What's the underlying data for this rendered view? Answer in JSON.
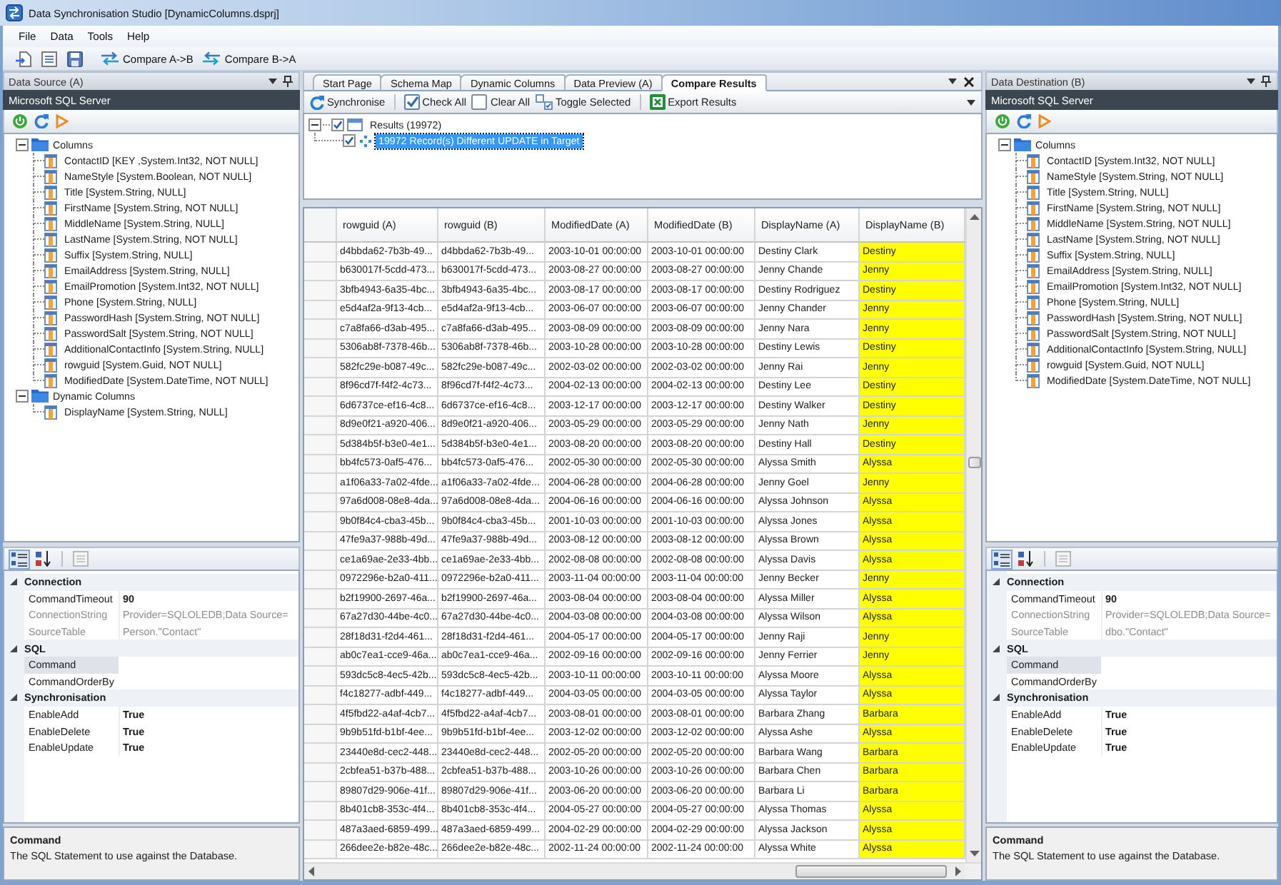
{
  "window": {
    "title": "Data Synchronisation Studio [DynamicColumns.dsprj]"
  },
  "menu": [
    {
      "label": "File"
    },
    {
      "label": "Data"
    },
    {
      "label": "Tools"
    },
    {
      "label": "Help"
    }
  ],
  "toolbar": [
    {
      "label": "Compare A->B"
    },
    {
      "label": "Compare B->A"
    }
  ],
  "source": {
    "title": "Data Source (A)",
    "provider": "Microsoft SQL Server",
    "tree": [
      {
        "label": "Columns",
        "expanded": true,
        "children": [
          {
            "label": "ContactID [KEY ,System.Int32, NOT NULL]"
          },
          {
            "label": "NameStyle [System.Boolean, NOT NULL]"
          },
          {
            "label": "Title [System.String, NULL]"
          },
          {
            "label": "FirstName [System.String, NOT NULL]"
          },
          {
            "label": "MiddleName [System.String, NULL]"
          },
          {
            "label": "LastName [System.String, NOT NULL]"
          },
          {
            "label": "Suffix [System.String, NULL]"
          },
          {
            "label": "EmailAddress [System.String, NULL]"
          },
          {
            "label": "EmailPromotion [System.Int32, NOT NULL]"
          },
          {
            "label": "Phone [System.String, NULL]"
          },
          {
            "label": "PasswordHash [System.String, NOT NULL]"
          },
          {
            "label": "PasswordSalt [System.String, NOT NULL]"
          },
          {
            "label": "AdditionalContactInfo [System.String, NULL]"
          },
          {
            "label": "rowguid [System.Guid, NOT NULL]"
          },
          {
            "label": "ModifiedDate [System.DateTime, NOT NULL]"
          }
        ]
      },
      {
        "label": "Dynamic Columns",
        "expanded": true,
        "children": [
          {
            "label": "DisplayName [System.String, NULL]"
          }
        ]
      }
    ],
    "property_views": [
      {
        "kind": "categorized",
        "selected": true,
        "disabled": false
      },
      {
        "kind": "alphabetical",
        "selected": false,
        "disabled": false
      },
      {
        "kind": "pages",
        "selected": false,
        "disabled": true
      }
    ],
    "properties": [
      {
        "category": "Connection",
        "expanded": true,
        "items": [
          {
            "name": "CommandTimeout",
            "value": "90",
            "modified": true,
            "readonly": false,
            "selected": false
          },
          {
            "name": "ConnectionString",
            "value": "Provider=SQLOLEDB;Data Source=",
            "modified": false,
            "readonly": true,
            "selected": false
          },
          {
            "name": "SourceTable",
            "value": "Person.\"Contact\"",
            "modified": false,
            "readonly": true,
            "selected": false
          }
        ]
      },
      {
        "category": "SQL",
        "expanded": true,
        "items": [
          {
            "name": "Command",
            "readonly": false,
            "selected": true
          },
          {
            "name": "CommandOrderBy",
            "readonly": false,
            "selected": false
          }
        ]
      },
      {
        "category": "Synchronisation",
        "expanded": true,
        "items": [
          {
            "name": "EnableAdd",
            "value": "True",
            "modified": true,
            "readonly": false,
            "selected": false
          },
          {
            "name": "EnableDelete",
            "value": "True",
            "modified": true,
            "readonly": false,
            "selected": false
          },
          {
            "name": "EnableUpdate",
            "value": "True",
            "modified": true,
            "readonly": false,
            "selected": false
          }
        ]
      }
    ],
    "description": {
      "title": "Command",
      "text": "The SQL Statement to use against the Database."
    }
  },
  "results": {
    "tabs": [
      {
        "label": "Start Page",
        "selected": false
      },
      {
        "label": "Schema Map",
        "selected": false
      },
      {
        "label": "Dynamic Columns",
        "selected": false
      },
      {
        "label": "Data Preview (A)",
        "selected": false
      },
      {
        "label": "Compare Results",
        "selected": true
      }
    ],
    "toolbar": [
      {
        "kind": "sync",
        "label": "Synchronise"
      },
      {
        "kind": "separator"
      },
      {
        "kind": "check",
        "label": "Check All"
      },
      {
        "kind": "clear",
        "label": "Clear All"
      },
      {
        "kind": "toggle",
        "label": "Toggle Selected"
      },
      {
        "kind": "separator"
      },
      {
        "kind": "export",
        "label": "Export Results"
      }
    ],
    "tree": [
      {
        "label": "Results (19972)",
        "checked": true,
        "expanded": true,
        "selected": false,
        "children": [
          {
            "label": "19972 Record(s) Different UPDATE in Target",
            "checked": true,
            "selected": true
          }
        ]
      }
    ],
    "grid": {
      "columns": [
        {
          "label": "rowguid (A)",
          "highlighted": false
        },
        {
          "label": "rowguid (B)",
          "highlighted": false
        },
        {
          "label": "ModifiedDate (A)",
          "highlighted": false
        },
        {
          "label": "ModifiedDate (B)",
          "highlighted": false
        },
        {
          "label": "DisplayName (A)",
          "highlighted": false
        },
        {
          "label": "DisplayName (B)",
          "highlighted": true
        }
      ],
      "rows": [
        [
          "d4bbda62-7b3b-49...",
          "d4bbda62-7b3b-49...",
          "2003-10-01 00:00:00",
          "2003-10-01 00:00:00",
          "Destiny Clark",
          "Destiny"
        ],
        [
          "b630017f-5cdd-473...",
          "b630017f-5cdd-473...",
          "2003-08-27 00:00:00",
          "2003-08-27 00:00:00",
          "Jenny Chande",
          "Jenny"
        ],
        [
          "3bfb4943-6a35-4bc...",
          "3bfb4943-6a35-4bc...",
          "2003-08-17 00:00:00",
          "2003-08-17 00:00:00",
          "Destiny Rodriguez",
          "Destiny"
        ],
        [
          "e5d4af2a-9f13-4cb...",
          "e5d4af2a-9f13-4cb...",
          "2003-06-07 00:00:00",
          "2003-06-07 00:00:00",
          "Jenny Chander",
          "Jenny"
        ],
        [
          "c7a8fa66-d3ab-495...",
          "c7a8fa66-d3ab-495...",
          "2003-08-09 00:00:00",
          "2003-08-09 00:00:00",
          "Jenny Nara",
          "Jenny"
        ],
        [
          "5306ab8f-7378-46b...",
          "5306ab8f-7378-46b...",
          "2003-10-28 00:00:00",
          "2003-10-28 00:00:00",
          "Destiny Lewis",
          "Destiny"
        ],
        [
          "582fc29e-b087-49c...",
          "582fc29e-b087-49c...",
          "2002-03-02 00:00:00",
          "2002-03-02 00:00:00",
          "Jenny Rai",
          "Jenny"
        ],
        [
          "8f96cd7f-f4f2-4c73...",
          "8f96cd7f-f4f2-4c73...",
          "2004-02-13 00:00:00",
          "2004-02-13 00:00:00",
          "Destiny Lee",
          "Destiny"
        ],
        [
          "6d6737ce-ef16-4c8...",
          "6d6737ce-ef16-4c8...",
          "2003-12-17 00:00:00",
          "2003-12-17 00:00:00",
          "Destiny Walker",
          "Destiny"
        ],
        [
          "8d9e0f21-a920-406...",
          "8d9e0f21-a920-406...",
          "2003-05-29 00:00:00",
          "2003-05-29 00:00:00",
          "Jenny Nath",
          "Jenny"
        ],
        [
          "5d384b5f-b3e0-4e1...",
          "5d384b5f-b3e0-4e1...",
          "2003-08-20 00:00:00",
          "2003-08-20 00:00:00",
          "Destiny Hall",
          "Destiny"
        ],
        [
          "bb4fc573-0af5-476...",
          "bb4fc573-0af5-476...",
          "2002-05-30 00:00:00",
          "2002-05-30 00:00:00",
          "Alyssa Smith",
          "Alyssa"
        ],
        [
          "a1f06a33-7a02-4fde...",
          "a1f06a33-7a02-4fde...",
          "2004-06-28 00:00:00",
          "2004-06-28 00:00:00",
          "Jenny Goel",
          "Jenny"
        ],
        [
          "97a6d008-08e8-4da...",
          "97a6d008-08e8-4da...",
          "2004-06-16 00:00:00",
          "2004-06-16 00:00:00",
          "Alyssa Johnson",
          "Alyssa"
        ],
        [
          "9b0f84c4-cba3-45b...",
          "9b0f84c4-cba3-45b...",
          "2001-10-03 00:00:00",
          "2001-10-03 00:00:00",
          "Alyssa Jones",
          "Alyssa"
        ],
        [
          "47fe9a37-988b-49d...",
          "47fe9a37-988b-49d...",
          "2003-08-12 00:00:00",
          "2003-08-12 00:00:00",
          "Alyssa Brown",
          "Alyssa"
        ],
        [
          "ce1a69ae-2e33-4bb...",
          "ce1a69ae-2e33-4bb...",
          "2002-08-08 00:00:00",
          "2002-08-08 00:00:00",
          "Alyssa Davis",
          "Alyssa"
        ],
        [
          "0972296e-b2a0-411...",
          "0972296e-b2a0-411...",
          "2003-11-04 00:00:00",
          "2003-11-04 00:00:00",
          "Jenny Becker",
          "Jenny"
        ],
        [
          "b2f19900-2697-46a...",
          "b2f19900-2697-46a...",
          "2003-08-04 00:00:00",
          "2003-08-04 00:00:00",
          "Alyssa Miller",
          "Alyssa"
        ],
        [
          "67a27d30-44be-4c0...",
          "67a27d30-44be-4c0...",
          "2004-03-08 00:00:00",
          "2004-03-08 00:00:00",
          "Alyssa Wilson",
          "Alyssa"
        ],
        [
          "28f18d31-f2d4-461...",
          "28f18d31-f2d4-461...",
          "2004-05-17 00:00:00",
          "2004-05-17 00:00:00",
          "Jenny Raji",
          "Jenny"
        ],
        [
          "ab0c7ea1-cce9-46a...",
          "ab0c7ea1-cce9-46a...",
          "2002-09-16 00:00:00",
          "2002-09-16 00:00:00",
          "Jenny Ferrier",
          "Jenny"
        ],
        [
          "593dc5c8-4ec5-42b...",
          "593dc5c8-4ec5-42b...",
          "2003-10-11 00:00:00",
          "2003-10-11 00:00:00",
          "Alyssa Moore",
          "Alyssa"
        ],
        [
          "f4c18277-adbf-449...",
          "f4c18277-adbf-449...",
          "2004-03-05 00:00:00",
          "2004-03-05 00:00:00",
          "Alyssa Taylor",
          "Alyssa"
        ],
        [
          "4f5fbd22-a4af-4cb7...",
          "4f5fbd22-a4af-4cb7...",
          "2003-08-01 00:00:00",
          "2003-08-01 00:00:00",
          "Barbara Zhang",
          "Barbara"
        ],
        [
          "9b9b51fd-b1bf-4ee...",
          "9b9b51fd-b1bf-4ee...",
          "2003-12-02 00:00:00",
          "2003-12-02 00:00:00",
          "Alyssa Ashe",
          "Alyssa"
        ],
        [
          "23440e8d-cec2-448...",
          "23440e8d-cec2-448...",
          "2002-05-20 00:00:00",
          "2002-05-20 00:00:00",
          "Barbara Wang",
          "Barbara"
        ],
        [
          "2cbfea51-b37b-488...",
          "2cbfea51-b37b-488...",
          "2003-10-26 00:00:00",
          "2003-10-26 00:00:00",
          "Barbara Chen",
          "Barbara"
        ],
        [
          "89807d29-906e-41f...",
          "89807d29-906e-41f...",
          "2003-06-20 00:00:00",
          "2003-06-20 00:00:00",
          "Barbara Li",
          "Barbara"
        ],
        [
          "8b401cb8-353c-4f4...",
          "8b401cb8-353c-4f4...",
          "2004-05-27 00:00:00",
          "2004-05-27 00:00:00",
          "Alyssa Thomas",
          "Alyssa"
        ],
        [
          "487a3aed-6859-499...",
          "487a3aed-6859-499...",
          "2004-02-29 00:00:00",
          "2004-02-29 00:00:00",
          "Alyssa Jackson",
          "Alyssa"
        ],
        [
          "266dee2e-b82e-48c...",
          "266dee2e-b82e-48c...",
          "2002-11-24 00:00:00",
          "2002-11-24 00:00:00",
          "Alyssa White",
          "Alyssa"
        ]
      ]
    }
  },
  "destination": {
    "title": "Data Destination (B)",
    "provider": "Microsoft SQL Server",
    "tree": [
      {
        "label": "Columns",
        "expanded": true,
        "children": [
          {
            "label": "ContactID [System.Int32, NOT NULL]"
          },
          {
            "label": "NameStyle [System.String, NOT NULL]"
          },
          {
            "label": "Title [System.String, NULL]"
          },
          {
            "label": "FirstName [System.String, NOT NULL]"
          },
          {
            "label": "MiddleName [System.String, NOT NULL]"
          },
          {
            "label": "LastName [System.String, NOT NULL]"
          },
          {
            "label": "Suffix [System.String, NULL]"
          },
          {
            "label": "EmailAddress [System.String, NULL]"
          },
          {
            "label": "EmailPromotion [System.Int32, NOT NULL]"
          },
          {
            "label": "Phone [System.String, NULL]"
          },
          {
            "label": "PasswordHash [System.String, NOT NULL]"
          },
          {
            "label": "PasswordSalt [System.String, NOT NULL]"
          },
          {
            "label": "AdditionalContactInfo [System.String, NULL]"
          },
          {
            "label": "rowguid [System.Guid, NOT NULL]"
          },
          {
            "label": "ModifiedDate [System.DateTime, NOT NULL]"
          }
        ]
      }
    ],
    "property_views": [
      {
        "kind": "categorized",
        "selected": true,
        "disabled": false
      },
      {
        "kind": "alphabetical",
        "selected": false,
        "disabled": false
      },
      {
        "kind": "pages",
        "selected": false,
        "disabled": true
      }
    ],
    "properties": [
      {
        "category": "Connection",
        "expanded": true,
        "items": [
          {
            "name": "CommandTimeout",
            "value": "90",
            "modified": true,
            "readonly": false,
            "selected": false
          },
          {
            "name": "ConnectionString",
            "value": "Provider=SQLOLEDB;Data Source=",
            "modified": false,
            "readonly": true,
            "selected": false
          },
          {
            "name": "SourceTable",
            "value": "dbo.\"Contact\"",
            "modified": false,
            "readonly": true,
            "selected": false
          }
        ]
      },
      {
        "category": "SQL",
        "expanded": true,
        "items": [
          {
            "name": "Command",
            "readonly": false,
            "selected": true
          },
          {
            "name": "CommandOrderBy",
            "readonly": false,
            "selected": false
          }
        ]
      },
      {
        "category": "Synchronisation",
        "expanded": true,
        "items": [
          {
            "name": "EnableAdd",
            "value": "True",
            "modified": true,
            "readonly": false,
            "selected": false
          },
          {
            "name": "EnableDelete",
            "value": "True",
            "modified": true,
            "readonly": false,
            "selected": false
          },
          {
            "name": "EnableUpdate",
            "value": "True",
            "modified": true,
            "readonly": false,
            "selected": false
          }
        ]
      }
    ],
    "description": {
      "title": "Command",
      "text": "The SQL Statement to use against the Database."
    }
  }
}
